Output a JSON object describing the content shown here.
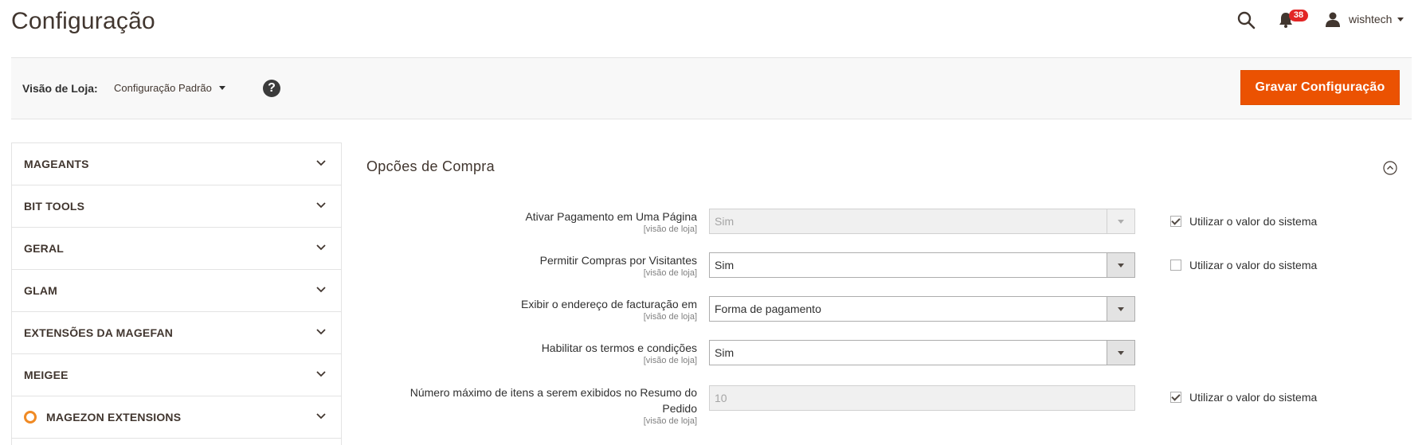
{
  "header": {
    "title": "Configuração",
    "notifications_count": "38",
    "username": "wishtech"
  },
  "store_scope": {
    "label": "Visão de Loja:",
    "value": "Configuração Padrão",
    "help": "?"
  },
  "toolbar": {
    "save_label": "Gravar Configuração"
  },
  "sidebar": {
    "items": [
      {
        "label": "MAGEANTS"
      },
      {
        "label": "BIT TOOLS"
      },
      {
        "label": "GERAL"
      },
      {
        "label": "GLAM"
      },
      {
        "label": "EXTENSÕES DA MAGEFAN"
      },
      {
        "label": "MEIGEE"
      },
      {
        "label": "MAGEZON EXTENSIONS",
        "icon": "magezon-logo-icon"
      }
    ]
  },
  "section": {
    "title": "Opcões de Compra",
    "fields": [
      {
        "label": "Ativar Pagamento em Uma Página",
        "scope": "[visão de loja]",
        "value": "Sim",
        "disabled": true,
        "use_system": true,
        "use_system_label": "Utilizar o valor do sistema"
      },
      {
        "label": "Permitir Compras por Visitantes",
        "scope": "[visão de loja]",
        "value": "Sim",
        "disabled": false,
        "use_system": false,
        "use_system_label": "Utilizar o valor do sistema"
      },
      {
        "label": "Exibir o endereço de facturação em",
        "scope": "[visão de loja]",
        "value": "Forma de pagamento",
        "disabled": false
      },
      {
        "label": "Habilitar os termos e condições",
        "scope": "[visão de loja]",
        "value": "Sim",
        "disabled": false
      },
      {
        "label_line1": "Número máximo de itens a serem exibidos no Resumo do",
        "label_line2": "Pedido",
        "scope": "[visão de loja]",
        "value": "10",
        "disabled": true,
        "use_system": true,
        "use_system_label": "Utilizar o valor do sistema"
      }
    ]
  },
  "colors": {
    "accent": "#eb5202",
    "badge": "#e22626",
    "text": "#303030"
  }
}
